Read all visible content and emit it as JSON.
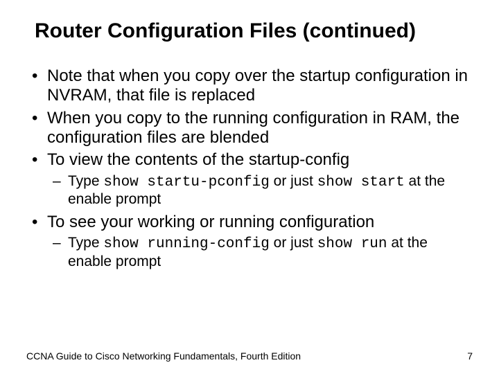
{
  "title": "Router Configuration Files (continued)",
  "b1": "Note that when you copy over the startup configuration in NVRAM, that file is replaced",
  "b2": "When you copy to the running configuration in RAM, the configuration files are blended",
  "b3": "To view the contents of the startup-config",
  "s3a": "Type ",
  "s3b": "show startu-pconfig",
  "s3c": " or just ",
  "s3d": "show start",
  "s3e": " at the enable prompt",
  "b4": "To see your working or running configuration",
  "s4a": "Type ",
  "s4b": "show running-config",
  "s4c": " or just ",
  "s4d": "show run",
  "s4e": " at the enable prompt",
  "footer": "CCNA Guide to Cisco Networking Fundamentals, Fourth Edition",
  "page": "7"
}
